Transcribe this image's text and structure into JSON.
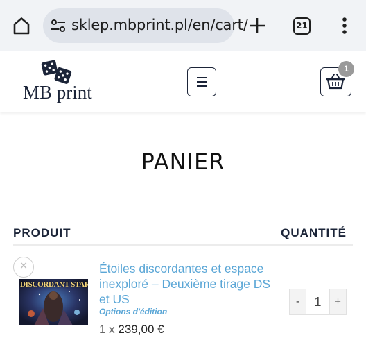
{
  "browser": {
    "url": "sklep.mbprint.pl/en/cart/",
    "tab_count": "21",
    "icons": {
      "home": "home-icon",
      "site_settings": "tune-icon",
      "new_tab": "plus-icon",
      "menu": "more-vert-icon"
    }
  },
  "header": {
    "logo_text": "MB print",
    "cart_count": "1",
    "icons": {
      "logo": "dice-icon",
      "menu": "hamburger-icon",
      "cart": "basket-icon"
    }
  },
  "page": {
    "title": "PANIER",
    "columns": {
      "product": "PRODUIT",
      "quantity": "QUANTITÉ"
    }
  },
  "cart": {
    "items": [
      {
        "thumb_title": "DISCORDANT STARS",
        "name": "Étoiles discordantes et espace inexploré – Deuxième tirage DS et US",
        "options_label": "Options d'édition",
        "price_prefix": "1 x",
        "price": "239,00 €",
        "quantity": "1",
        "qty_minus": "-",
        "qty_plus": "+",
        "remove": "×"
      }
    ]
  },
  "colors": {
    "accent_link": "#5aa6d6",
    "brand_navy": "#1b2438",
    "badge": "#9a9a9a"
  }
}
